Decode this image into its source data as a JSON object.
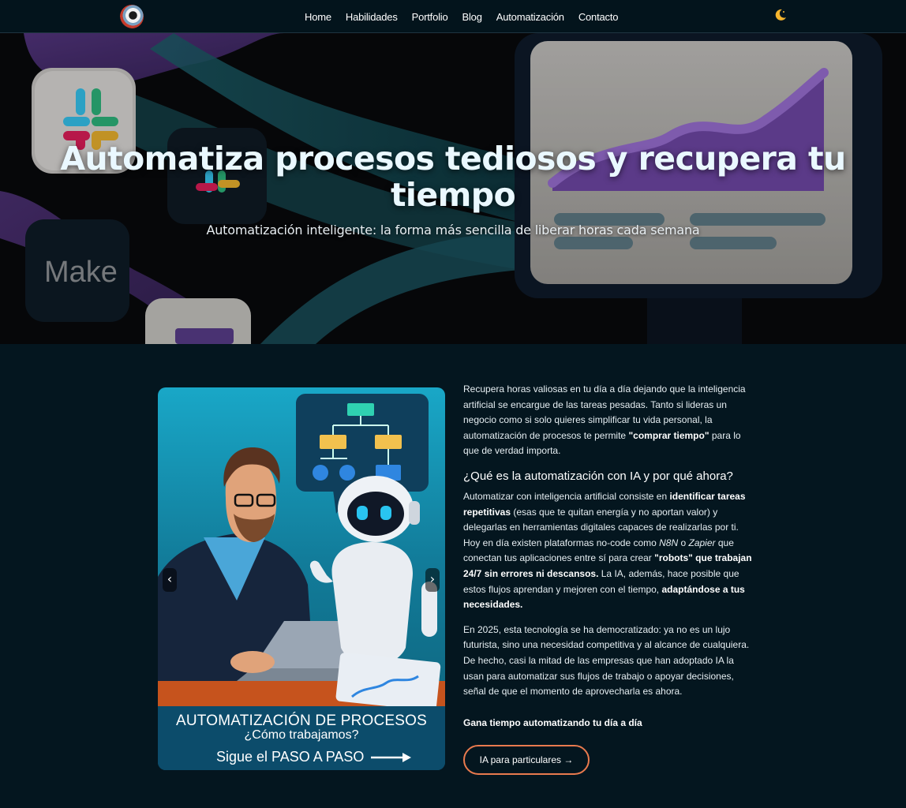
{
  "nav": {
    "items": [
      {
        "label": "Home"
      },
      {
        "label": "Habilidades"
      },
      {
        "label": "Portfolio"
      },
      {
        "label": "Blog"
      },
      {
        "label": "Automatización"
      },
      {
        "label": "Contacto"
      }
    ],
    "theme_icon": "moon-icon"
  },
  "hero": {
    "title": "Automatiza procesos tediosos y recupera tu tiempo",
    "subtitle": "Automatización inteligente: la forma más sencilla de liberar horas cada semana",
    "make_label": "Make"
  },
  "carousel": {
    "prev_label": "‹",
    "next_label": "›",
    "caption_title": "AUTOMATIZACIÓN DE PROCESOS",
    "caption_sub": "¿Cómo trabajamos?",
    "caption_cta": "Sigue el PASO A PASO"
  },
  "article": {
    "p1_a": "Recupera horas valiosas en tu día a día dejando que la inteligencia artificial se encargue de las tareas pesadas. Tanto si lideras un negocio como si solo quieres simplificar tu vida personal, la automatización de procesos te permite ",
    "p1_bold": "\"comprar tiempo\"",
    "p1_b": " para lo que de verdad importa.",
    "heading": "¿Qué es la automatización con IA y por qué ahora?",
    "p2_a": "Automatizar con inteligencia artificial consiste en ",
    "p2_bold1": "identificar tareas repetitivas",
    "p2_b": " (esas que te quitan energía y no aportan valor) y delegarlas en herramientas digitales capaces de realizarlas por ti. Hoy en día existen plataformas no-code como ",
    "p2_i1": "N8N",
    "p2_c": " o ",
    "p2_i2": "Zapier",
    "p2_d": " que conectan tus aplicaciones entre sí para crear ",
    "p2_bold2": "\"robots\" que trabajan 24/7 sin errores ni descansos.",
    "p2_e": " La IA, además, hace posible que estos flujos aprendan y mejoren con el tiempo, ",
    "p2_bold3": "adaptándose a tus necesidades.",
    "p3": "En 2025, esta tecnología se ha democratizado: ya no es un lujo futurista, sino una necesidad competitiva y al alcance de cualquiera. De hecho, casi la mitad de las empresas que han adoptado IA la usan para automatizar sus flujos de trabajo o apoyar decisiones, señal de que el momento de aprovecharla es ahora.",
    "cta_line": "Gana tiempo automatizando tu día a día",
    "cta_button": "IA para particulares →"
  },
  "colors": {
    "background": "#04161f",
    "nav_background": "#03141c",
    "accent_button_border": "#e97a4e",
    "carousel_caption": "#0c4c6b",
    "moon": "#f5b52e"
  }
}
